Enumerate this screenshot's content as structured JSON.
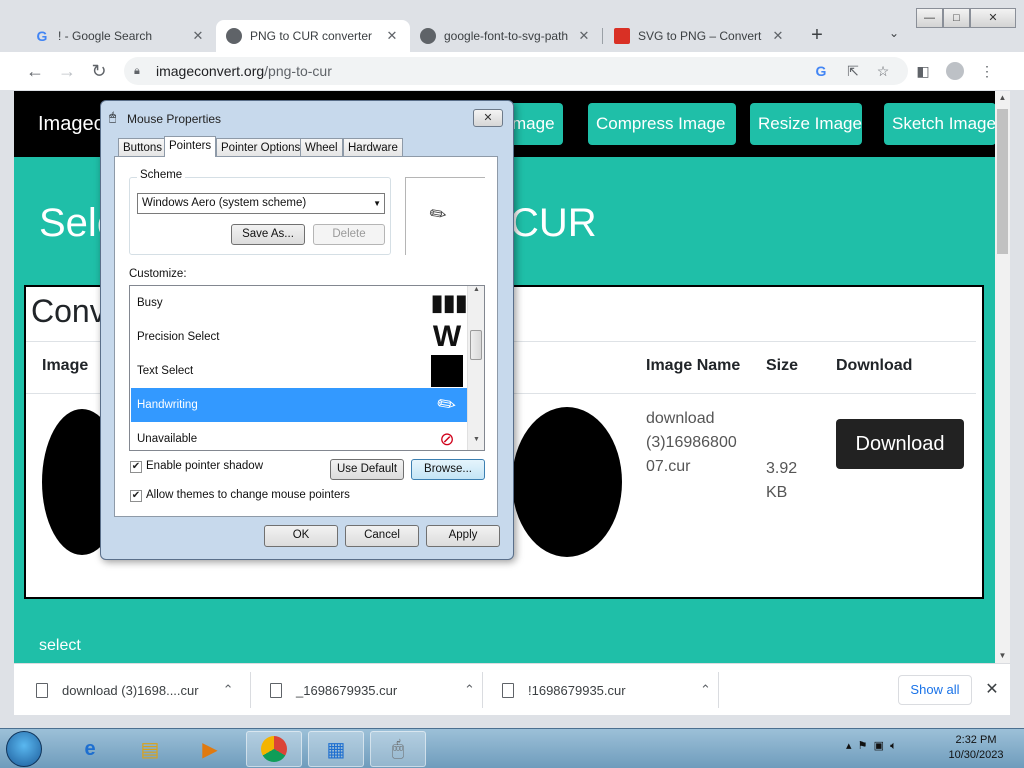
{
  "browser": {
    "tabs": [
      {
        "title": "! - Google Search",
        "icon": "google-icon"
      },
      {
        "title": "PNG to CUR converter",
        "icon": "globe-icon"
      },
      {
        "title": "google-font-to-svg-path",
        "icon": "globe-icon"
      },
      {
        "title": "SVG to PNG – Convert",
        "icon": "svg-png-icon"
      }
    ],
    "url_host": "imageconvert.org",
    "url_path": "/png-to-cur",
    "window_buttons": {
      "minimize": "—",
      "maximize": "□",
      "close": "✕"
    }
  },
  "site": {
    "logo": "Imagec",
    "nav": [
      "mage",
      "Compress Image",
      "Resize Image",
      "Sketch Image"
    ],
    "heading_left": "Sele",
    "heading_right": "CUR",
    "convert_title": "Conv",
    "table_headers": [
      "Image",
      "Image Name",
      "Size",
      "Download"
    ],
    "file_name": "download (3)16986800 07.cur",
    "file_size": "3.92 KB",
    "download_label": "Download",
    "select_label": "select"
  },
  "downloads": {
    "items": [
      "download (3)1698....cur",
      "_1698679935.cur",
      "!1698679935.cur"
    ],
    "show_all": "Show all"
  },
  "dialog": {
    "title": "Mouse Properties",
    "tabs": [
      "Buttons",
      "Pointers",
      "Pointer Options",
      "Wheel",
      "Hardware"
    ],
    "scheme_label": "Scheme",
    "scheme_value": "Windows Aero (system scheme)",
    "save_as": "Save As...",
    "delete": "Delete",
    "customize_label": "Customize:",
    "cursor_rows": [
      {
        "label": "Busy",
        "cursor": "busy-cursor-icon"
      },
      {
        "label": "Precision Select",
        "cursor": "precision-cursor-icon"
      },
      {
        "label": "Text Select",
        "cursor": "text-select-cursor-icon"
      },
      {
        "label": "Handwriting",
        "cursor": "pen-cursor-icon"
      },
      {
        "label": "Unavailable",
        "cursor": "unavailable-cursor-icon"
      }
    ],
    "enable_shadow": "Enable pointer shadow",
    "allow_themes": "Allow themes to change mouse pointers",
    "use_default": "Use Default",
    "browse": "Browse...",
    "ok": "OK",
    "cancel": "Cancel",
    "apply": "Apply"
  },
  "taskbar": {
    "time": "2:32 PM",
    "date": "10/30/2023"
  },
  "colors": {
    "accent": "#1fbfa8",
    "selection": "#3399ff"
  }
}
